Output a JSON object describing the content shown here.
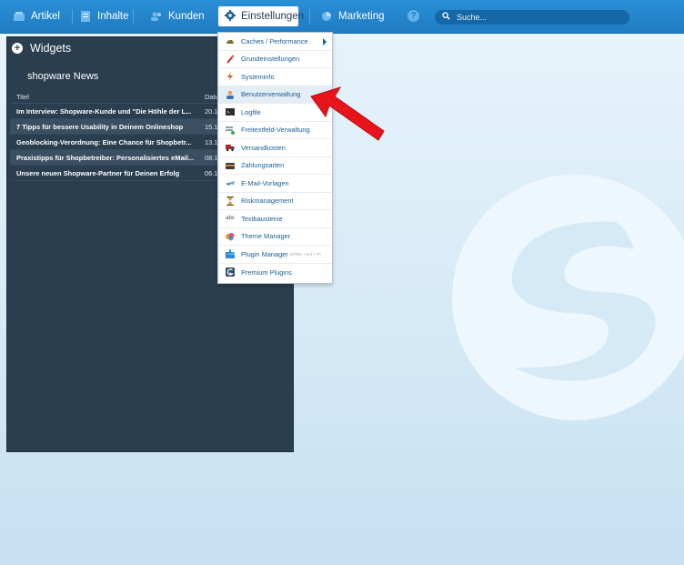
{
  "topbar": {
    "items": [
      {
        "label": "Artikel",
        "icon": "article-icon"
      },
      {
        "label": "Inhalte",
        "icon": "content-icon"
      },
      {
        "label": "Kunden",
        "icon": "customers-icon"
      },
      {
        "label": "Einstellungen",
        "icon": "gear-icon"
      },
      {
        "label": "Marketing",
        "icon": "marketing-icon"
      }
    ],
    "help_glyph": "?",
    "search_placeholder": "Suche..."
  },
  "widgets": {
    "title": "Widgets",
    "news": {
      "title": "shopware News",
      "columns": [
        "Titel",
        "Datum"
      ],
      "rows": [
        {
          "title": "Im Interview: Shopware-Kunde und \"Die Höhle der L...",
          "date": "20.11.2"
        },
        {
          "title": "7 Tipps für bessere Usability in Deinem Onlineshop",
          "date": "15.11.2"
        },
        {
          "title": "Geoblocking-Verordnung: Eine Chance für Shopbetr...",
          "date": "13.11.2"
        },
        {
          "title": "Praxistipps für Shopbetreiber: Personalisiertes eMail...",
          "date": "08.11.2"
        },
        {
          "title": "Unsere neuen Shopware-Partner für Deinen Erfolg",
          "date": "06.11.2"
        }
      ]
    }
  },
  "settings_menu": {
    "items": [
      {
        "label": "Caches / Performance",
        "icon": "speedometer-icon",
        "submenu": true
      },
      {
        "label": "Grundeinstellungen",
        "icon": "wrench-icon"
      },
      {
        "label": "Systeminfo",
        "icon": "lightning-icon"
      },
      {
        "label": "Benutzerverwaltung",
        "icon": "user-icon",
        "active": true
      },
      {
        "label": "Logfile",
        "icon": "terminal-icon"
      },
      {
        "label": "Freitextfeld-Verwaltung",
        "icon": "textfield-icon"
      },
      {
        "label": "Versandkosten",
        "icon": "truck-icon"
      },
      {
        "label": "Zahlungsarten",
        "icon": "credit-card-icon"
      },
      {
        "label": "E-Mail-Vorlagen",
        "icon": "email-icon"
      },
      {
        "label": "Riskmanagement",
        "icon": "hourglass-icon"
      },
      {
        "label": "Textbausteine",
        "icon": "abc-icon",
        "glyph": "abc"
      },
      {
        "label": "Theme Manager",
        "icon": "palette-icon"
      },
      {
        "label": "Plugin Manager",
        "icon": "puzzle-icon",
        "hint": "(STRG + ALT + P)"
      },
      {
        "label": "Premium Plugins",
        "icon": "shopware-icon"
      }
    ]
  },
  "colors": {
    "topbar": "#1f7cc2",
    "panel": "#2b3e4f",
    "menu_text": "#1b5d96",
    "arrow": "#e8141c"
  }
}
